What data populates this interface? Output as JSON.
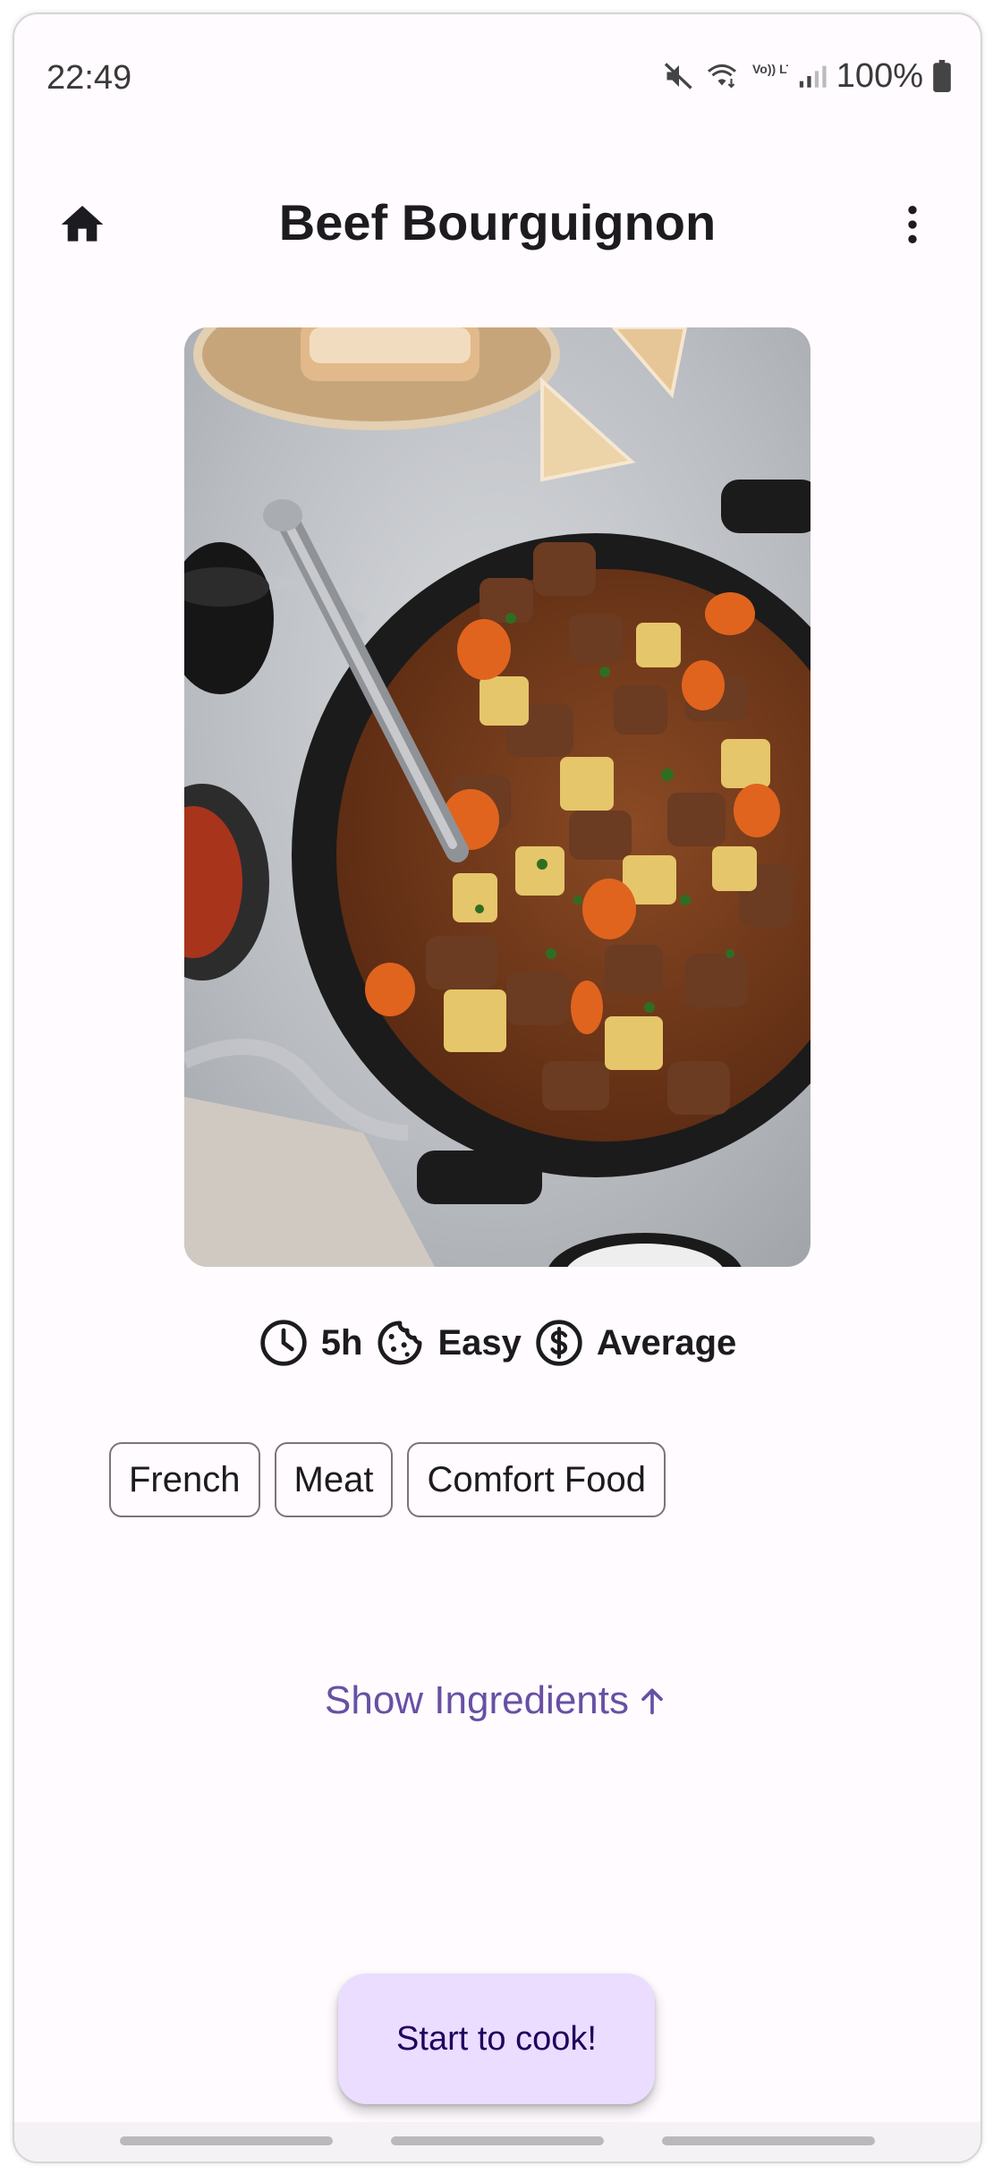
{
  "status_bar": {
    "time": "22:49",
    "battery": "100%",
    "icons": [
      "mute-icon",
      "wifi-icon",
      "volte-icon",
      "signal-icon",
      "battery-icon"
    ],
    "volte_label": "Vo)) LTE1"
  },
  "app_bar": {
    "title": "Beef Bourguignon",
    "home_icon": "home-icon",
    "more_icon": "more-vert-icon"
  },
  "recipe": {
    "duration": "5h",
    "difficulty": "Easy",
    "cost": "Average",
    "tags": [
      "French",
      "Meat",
      "Comfort Food"
    ]
  },
  "actions": {
    "show_ingredients": "Show Ingredients",
    "start_cooking": "Start to cook!"
  },
  "colors": {
    "accent": "#6750a4",
    "fab_background": "#eaddff",
    "fab_text": "#21005d",
    "background": "#fffbfe"
  }
}
